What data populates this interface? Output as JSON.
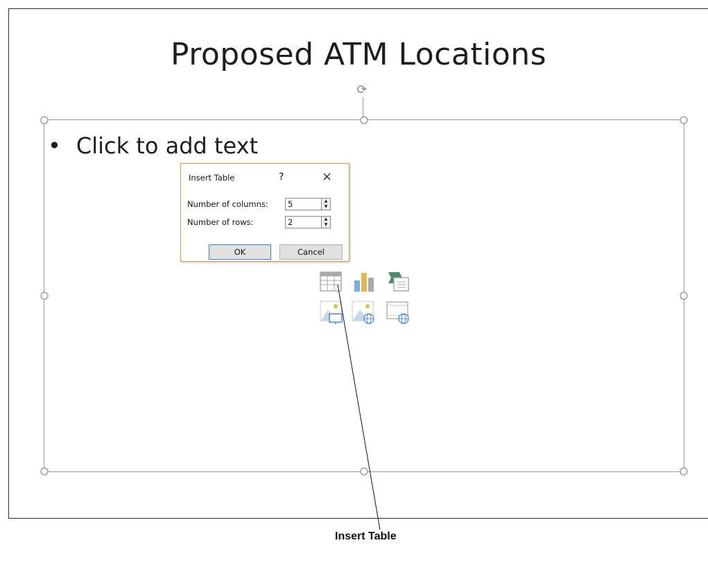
{
  "slide": {
    "title": "Proposed ATM Locations",
    "bullet_text": "Click to add text"
  },
  "dialog": {
    "title": "Insert Table",
    "help_glyph": "?",
    "close_glyph": "×",
    "columns_label": "Number of columns:",
    "columns_value": "5",
    "rows_label": "Number of rows:",
    "rows_value": "2",
    "ok_label": "OK",
    "cancel_label": "Cancel"
  },
  "content_icons": [
    "insert-table-icon",
    "insert-chart-icon",
    "insert-smartart-icon",
    "pictures-icon",
    "online-pictures-icon",
    "insert-video-icon"
  ],
  "callout": {
    "label": "Insert Table"
  },
  "colors": {
    "dialog_border": "#d79a4a",
    "ok_focus": "#3d7ad8",
    "icon_gray": "#a9a9a9",
    "icon_blue": "#79aee0",
    "icon_green": "#4b8a6f"
  }
}
